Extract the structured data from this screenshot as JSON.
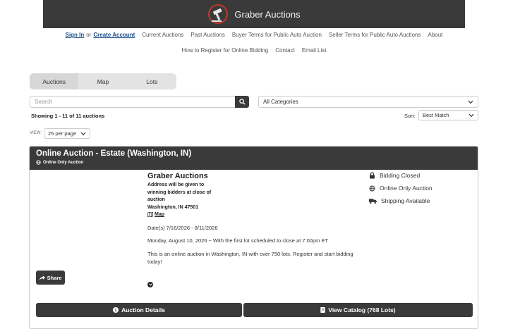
{
  "brand": {
    "name": "Graber Auctions"
  },
  "nav": {
    "sign_in": "Sign In",
    "or": "or",
    "create_account": "Create Account",
    "items_row1": [
      "Current Auctions",
      "Past Auctions",
      "Buyer Terms for Public Auto Auction",
      "Seller Terms for Public Auto Auctions",
      "About"
    ],
    "items_row2": [
      "How to Register for Online Bidding",
      "Contact",
      "Email List"
    ]
  },
  "tabs": [
    "Auctions",
    "Map",
    "Lots"
  ],
  "search": {
    "placeholder": "Search"
  },
  "category": {
    "selected": "All Categories"
  },
  "results": {
    "showing": "Showing 1 - 11 of 11 auctions"
  },
  "sort": {
    "label": "Sort:",
    "selected": "Best Match"
  },
  "view": {
    "label": "VIEW:",
    "selected": "25 per page"
  },
  "auction": {
    "title": "Online Auction - Estate (Washington, IN)",
    "type_badge": "Online Only Auction",
    "seller": "Graber Auctions",
    "address_lines": [
      "Address will be given to",
      "winning bidders at close of",
      "auction"
    ],
    "city": "Washington, IN 47501",
    "map_link": "Map",
    "dates": "Date(s) 7/16/2026 - 8/11/2026",
    "schedule": "Monday, August 10, 2026 ~ With the first lot scheduled to close at 7:00pm ET",
    "description": "This is an online auction in Washington, IN with over 750 lots. Register and start bidding today!",
    "status": [
      "Bidding Closed",
      "Online Only Auction",
      "Shipping Available"
    ],
    "share_label": "Share",
    "details_label": "Auction Details",
    "catalog_label": "View Catalog (768 Lots)"
  },
  "colors": {
    "dark": "#3a3a3a",
    "link_blue": "#1a4f8a",
    "accent_red": "#c0392b"
  }
}
